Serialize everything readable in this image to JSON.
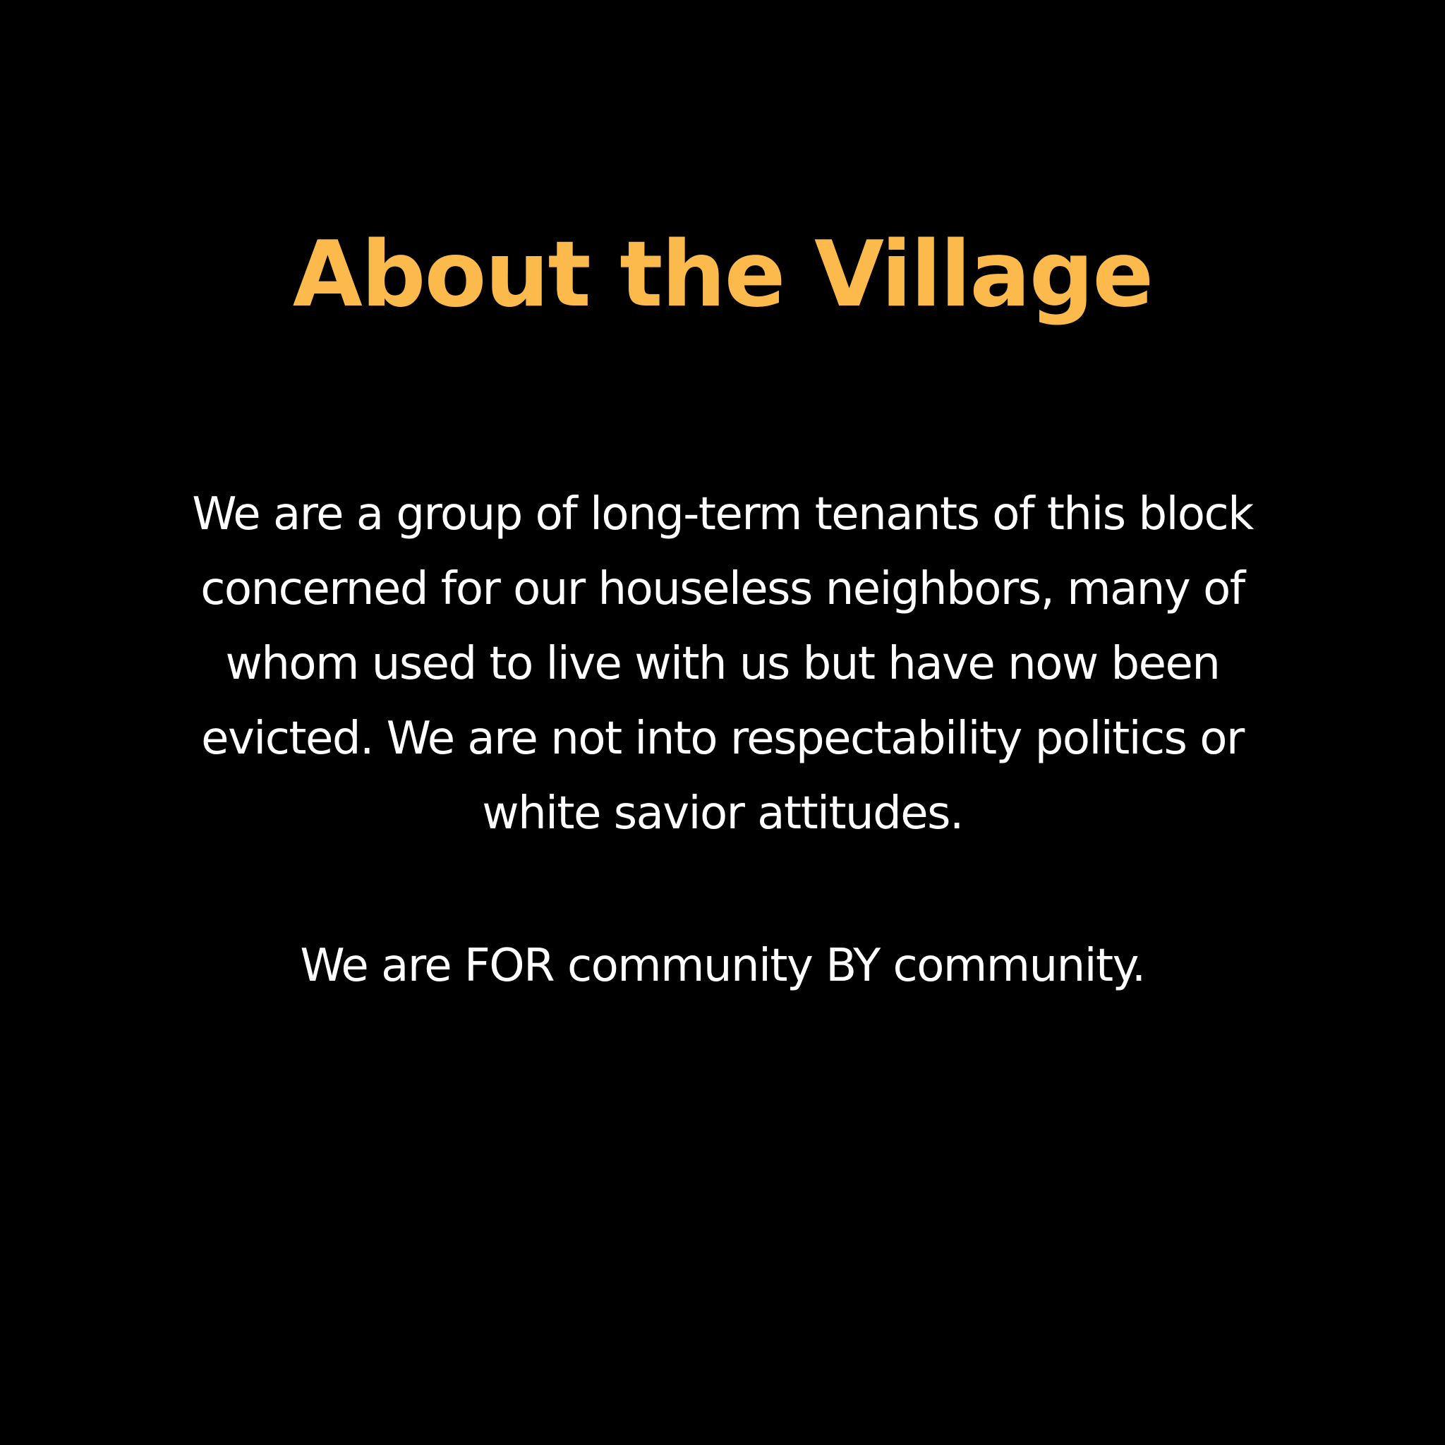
{
  "title": "About the Village",
  "description_lines": [
    "We are a group of long-term tenants of this block",
    "concerned for our houseless neighbors, many of",
    "whom used to live with us but have now been",
    "evicted. We are not into respectability politics or",
    "white savior attitudes."
  ],
  "tagline": "We are FOR community BY community.",
  "colors": {
    "background": "#000000",
    "title": "#FDBA4C",
    "text": "#FFFFFF"
  }
}
